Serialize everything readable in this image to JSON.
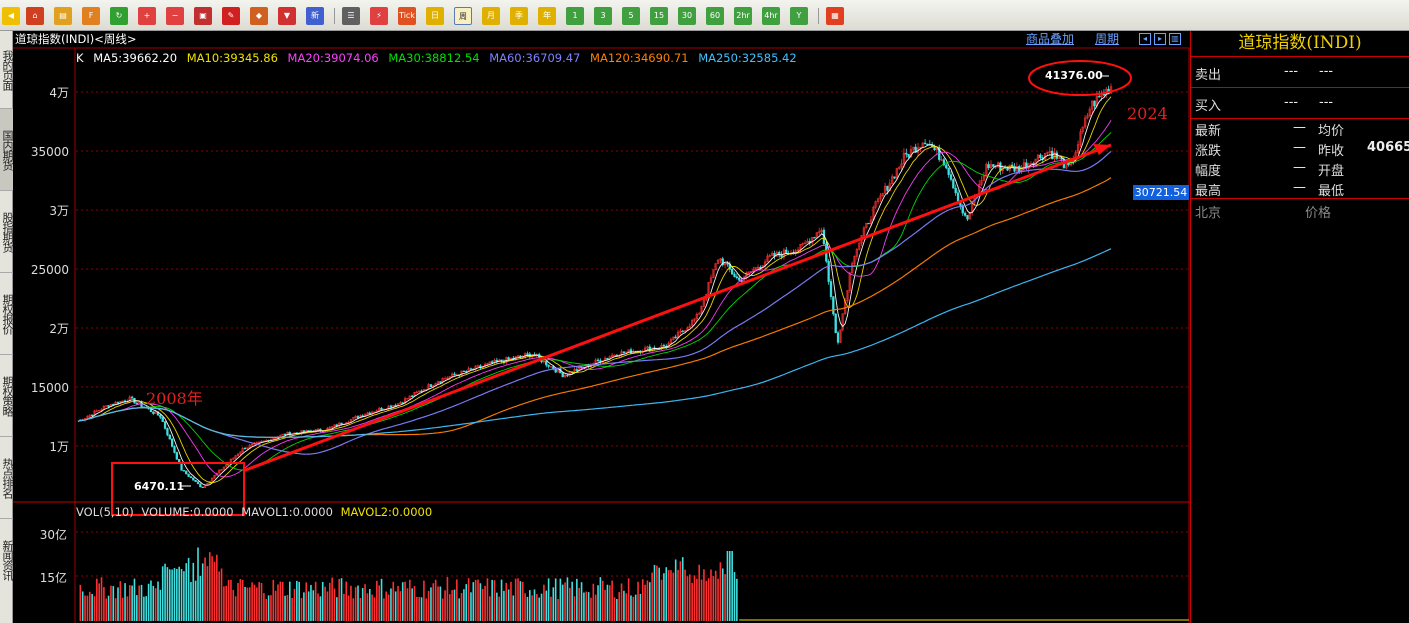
{
  "toolbar": {
    "icons": [
      "back-arrow-icon",
      "home-icon",
      "layers-icon",
      "fund-icon",
      "refresh-icon",
      "zoom-in-icon",
      "zoom-out-icon",
      "windows-icon",
      "pencil-icon",
      "paint-icon",
      "filter-icon",
      "new-icon",
      "table-icon",
      "chart-icon",
      "tick-icon",
      "day-icon",
      "week-icon",
      "month-icon",
      "season-icon",
      "year-icon",
      "min1-icon",
      "min3-icon",
      "min5-icon",
      "min15-icon",
      "min30-icon",
      "min60-icon",
      "hour2-icon",
      "hour4-icon",
      "custom-period-icon",
      "grid-icon"
    ],
    "tick_label": "Tick",
    "day_label": "日",
    "week_label": "周",
    "month_label": "月",
    "season_label": "季",
    "year_label": "年",
    "m1": "1",
    "m3": "3",
    "m5": "5",
    "m15": "15",
    "m30": "30",
    "m60": "60",
    "h2": "2hr",
    "h4": "4hr",
    "custom": "Y"
  },
  "sidebar": {
    "items": [
      {
        "label": "我的页面"
      },
      {
        "label": "国内期货"
      },
      {
        "label": "股指期货"
      },
      {
        "label": "期权报价"
      },
      {
        "label": "期权策略"
      },
      {
        "label": "热点排名"
      },
      {
        "label": "新闻资讯"
      }
    ]
  },
  "chart_header": {
    "title": "道琼指数(INDI)<周线>",
    "overlay_link": "商品叠加",
    "period_link": "周期"
  },
  "ma": {
    "k": "K",
    "ma5": "MA5:39662.20",
    "ma10": "MA10:39345.86",
    "ma20": "MA20:39074.06",
    "ma30": "MA30:38812.54",
    "ma60": "MA60:36709.47",
    "ma120": "MA120:34690.71",
    "ma250": "MA250:32585.42",
    "colors": {
      "k": "#ffffff",
      "ma5": "#ffffff",
      "ma10": "#f0e000",
      "ma20": "#ff40ff",
      "ma30": "#00e000",
      "ma60": "#8080ff",
      "ma120": "#ff8000",
      "ma250": "#40c0ff"
    }
  },
  "vol": {
    "label": "VOL(5,10)",
    "volume": "VOLUME:0.0000",
    "mavol1": "MAVOL1:0.0000",
    "mavol2": "MAVOL2:0.0000",
    "y_labels": [
      "30亿",
      "15亿"
    ]
  },
  "chart_data": {
    "type": "candlestick",
    "y_labels": [
      "4万",
      "35000",
      "3万",
      "25000",
      "2万",
      "15000",
      "1万"
    ],
    "y_values": [
      40000,
      35000,
      30000,
      25000,
      20000,
      15000,
      10000
    ],
    "low_label": "6470.11",
    "high_label": "41376.00",
    "cursor_value": "30721.54",
    "annotations": {
      "start": "2008年",
      "end": "2024"
    },
    "key_points": [
      {
        "t": 0,
        "v": 12100
      },
      {
        "t": 0.03,
        "v": 13500
      },
      {
        "t": 0.05,
        "v": 14000
      },
      {
        "t": 0.08,
        "v": 12500
      },
      {
        "t": 0.1,
        "v": 8000
      },
      {
        "t": 0.12,
        "v": 6470
      },
      {
        "t": 0.16,
        "v": 9800
      },
      {
        "t": 0.2,
        "v": 11000
      },
      {
        "t": 0.24,
        "v": 11400
      },
      {
        "t": 0.28,
        "v": 12800
      },
      {
        "t": 0.31,
        "v": 13600
      },
      {
        "t": 0.35,
        "v": 15600
      },
      {
        "t": 0.4,
        "v": 17000
      },
      {
        "t": 0.44,
        "v": 17800
      },
      {
        "t": 0.47,
        "v": 16000
      },
      {
        "t": 0.52,
        "v": 17800
      },
      {
        "t": 0.57,
        "v": 18500
      },
      {
        "t": 0.6,
        "v": 21000
      },
      {
        "t": 0.62,
        "v": 26000
      },
      {
        "t": 0.64,
        "v": 24000
      },
      {
        "t": 0.67,
        "v": 26000
      },
      {
        "t": 0.7,
        "v": 26800
      },
      {
        "t": 0.72,
        "v": 28500
      },
      {
        "t": 0.735,
        "v": 18600
      },
      {
        "t": 0.75,
        "v": 26000
      },
      {
        "t": 0.77,
        "v": 30000
      },
      {
        "t": 0.8,
        "v": 34500
      },
      {
        "t": 0.82,
        "v": 36000
      },
      {
        "t": 0.84,
        "v": 34000
      },
      {
        "t": 0.86,
        "v": 29000
      },
      {
        "t": 0.88,
        "v": 33800
      },
      {
        "t": 0.91,
        "v": 33500
      },
      {
        "t": 0.94,
        "v": 35000
      },
      {
        "t": 0.96,
        "v": 33500
      },
      {
        "t": 0.98,
        "v": 38800
      },
      {
        "t": 1.0,
        "v": 40500
      }
    ]
  },
  "quote": {
    "title": "道琼指数(INDI)",
    "sell_label": "卖出",
    "buy_label": "买入",
    "dash3": "---",
    "latest": "最新",
    "avg": "均价",
    "change": "涨跌",
    "prev_close": "昨收",
    "prev_close_val": "40665.",
    "amp": "幅度",
    "open": "开盘",
    "high": "最高",
    "low": "最低",
    "dash": "—",
    "beijing": "北京",
    "price": "价格"
  }
}
